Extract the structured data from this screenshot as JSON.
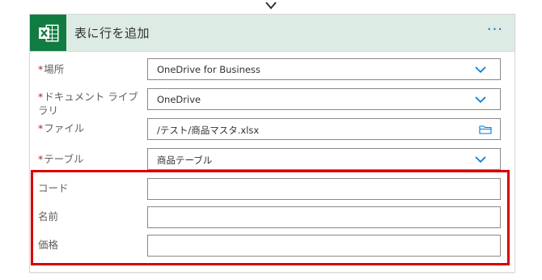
{
  "colors": {
    "excel_green": "#107c41",
    "header_bg": "#dcebe3",
    "accent_blue": "#0078d4",
    "required_red": "#a4262c",
    "highlight_red": "#d80000"
  },
  "connector": {
    "icon": "chevron-down-icon"
  },
  "card": {
    "app_icon": "excel-icon",
    "title": "表に行を追加",
    "more_label": "···"
  },
  "fields": [
    {
      "label": "場所",
      "required": true,
      "value": "OneDrive for Business",
      "control": "dropdown",
      "icon": "chevron-down-icon"
    },
    {
      "label": "ドキュメント ライブラリ",
      "required": true,
      "value": "OneDrive",
      "control": "dropdown",
      "icon": "chevron-down-icon"
    },
    {
      "label": "ファイル",
      "required": true,
      "value": "/テスト/商品マスタ.xlsx",
      "control": "file-picker",
      "icon": "folder-icon"
    },
    {
      "label": "テーブル",
      "required": true,
      "value": "商品テーブル",
      "control": "dropdown",
      "icon": "chevron-down-icon"
    },
    {
      "label": "コード",
      "required": false,
      "value": "",
      "control": "text"
    },
    {
      "label": "名前",
      "required": false,
      "value": "",
      "control": "text"
    },
    {
      "label": "価格",
      "required": false,
      "value": "",
      "control": "text"
    }
  ],
  "required_marker": "*"
}
